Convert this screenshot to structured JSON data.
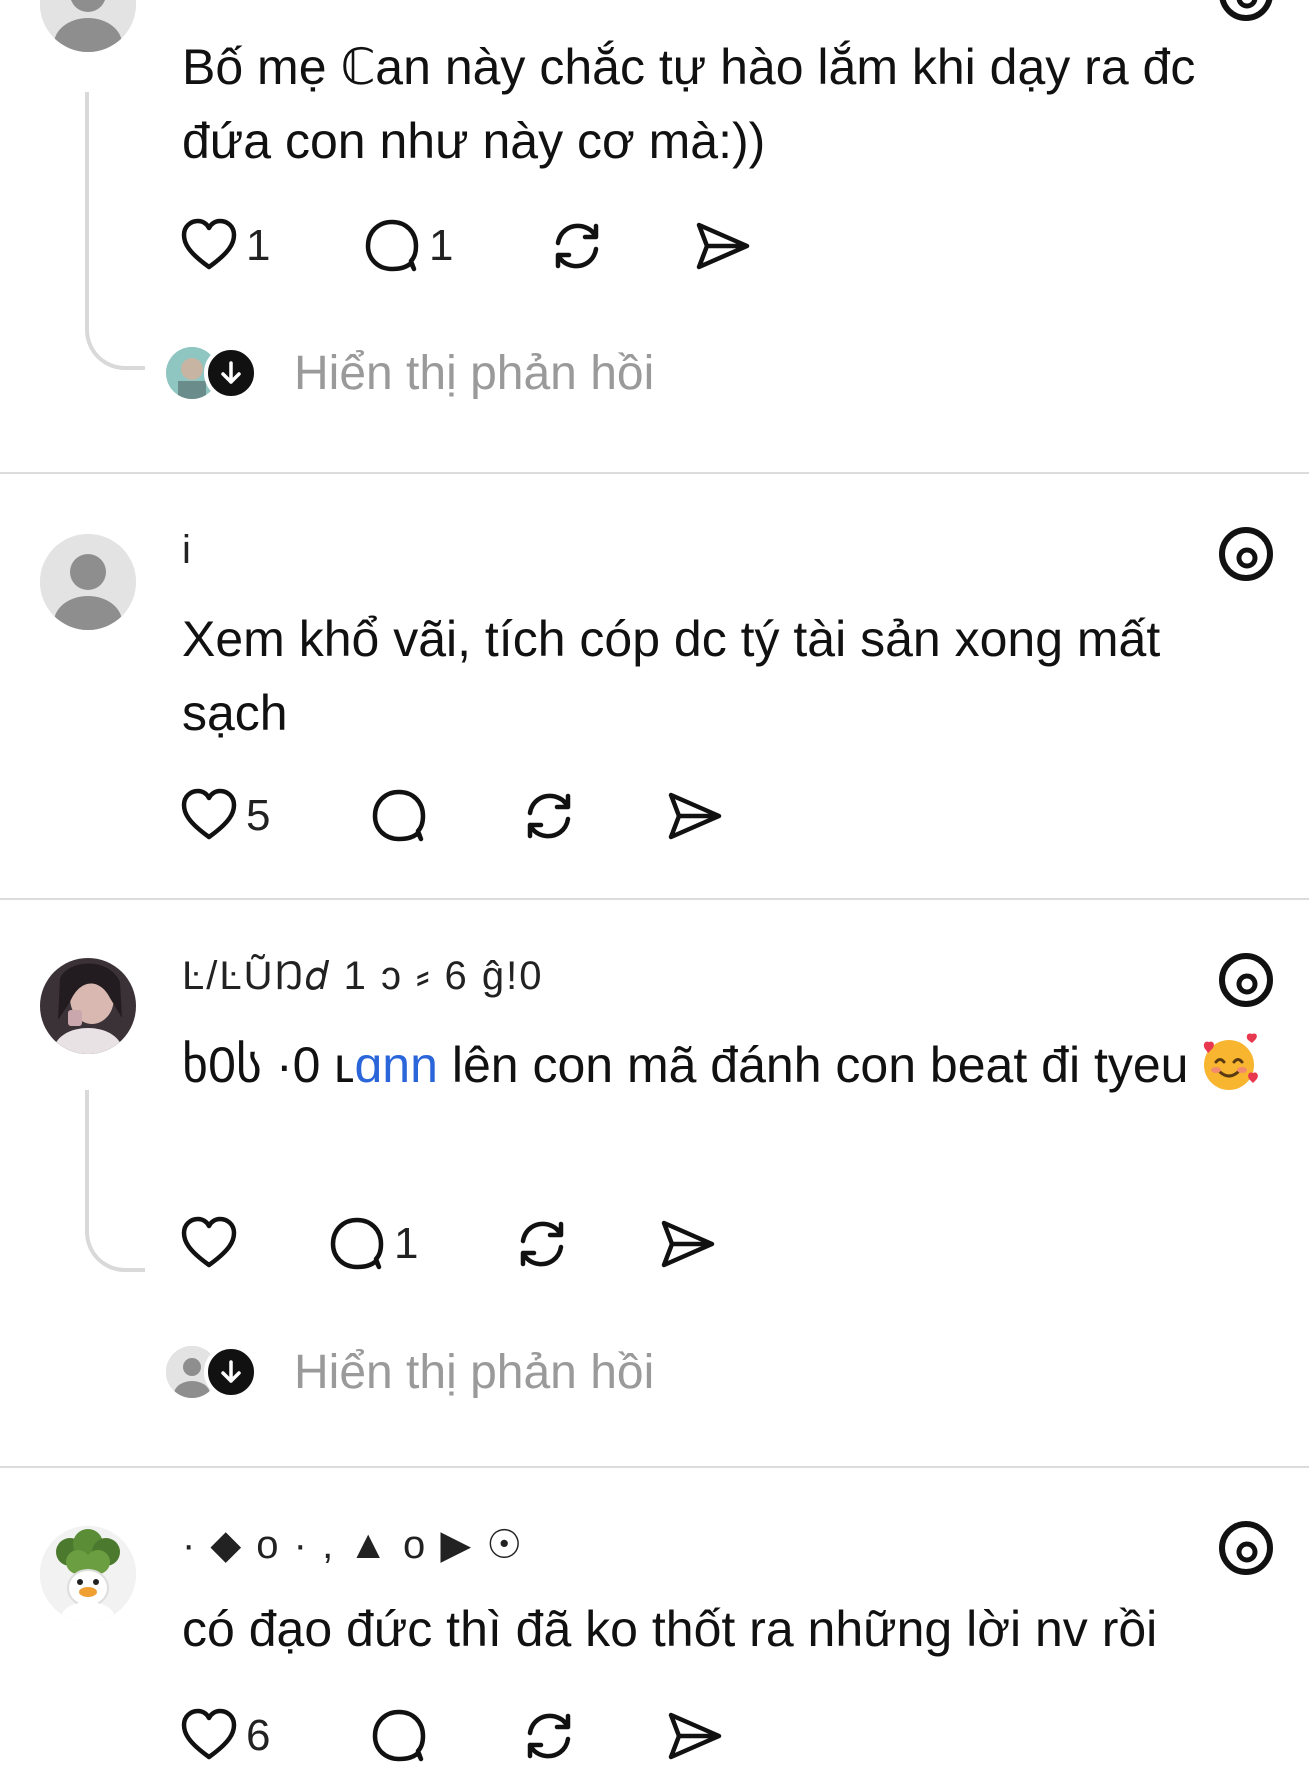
{
  "colors": {
    "divider": "#dcdcdc",
    "text": "#111111",
    "muted": "#9a9a9a",
    "mention": "#2a66d9",
    "thread_line": "#d9d9d9"
  },
  "icons": {
    "like": "heart-icon",
    "comment": "comment-icon",
    "repost": "repost-icon",
    "share": "share-icon",
    "app": "threads-icon"
  },
  "posts": [
    {
      "username": "",
      "text": "Bố mẹ  ℂan này chắc tự hào lắm khi dạy ra đc đứa con như này cơ mà:))",
      "likes": "1",
      "comments": "1",
      "show_replies": "Hiển thị phản hồi"
    },
    {
      "username": "i",
      "text": "Xem khổ vãi, tích cóp dc tý tài sản xong mất sạch",
      "likes": "5",
      "comments": ""
    },
    {
      "username": "Ŀ/ĿŨŊ𝑑 1 ͻ  ⸗ 6 ĝ!0",
      "mention_prefix": "ხ0ს ·0 ʟ",
      "mention": "ɑnn",
      "text": " lên con mã đánh con beat đi tyeu",
      "likes": "",
      "comments": "1",
      "show_replies": "Hiển thị phản hồi"
    },
    {
      "username": "·  ◆ o ·  , ▲ o  ▶ ☉",
      "text": "có đạo đức thì đã ko thốt ra những lời nv rồi",
      "likes": "6",
      "comments": ""
    }
  ]
}
